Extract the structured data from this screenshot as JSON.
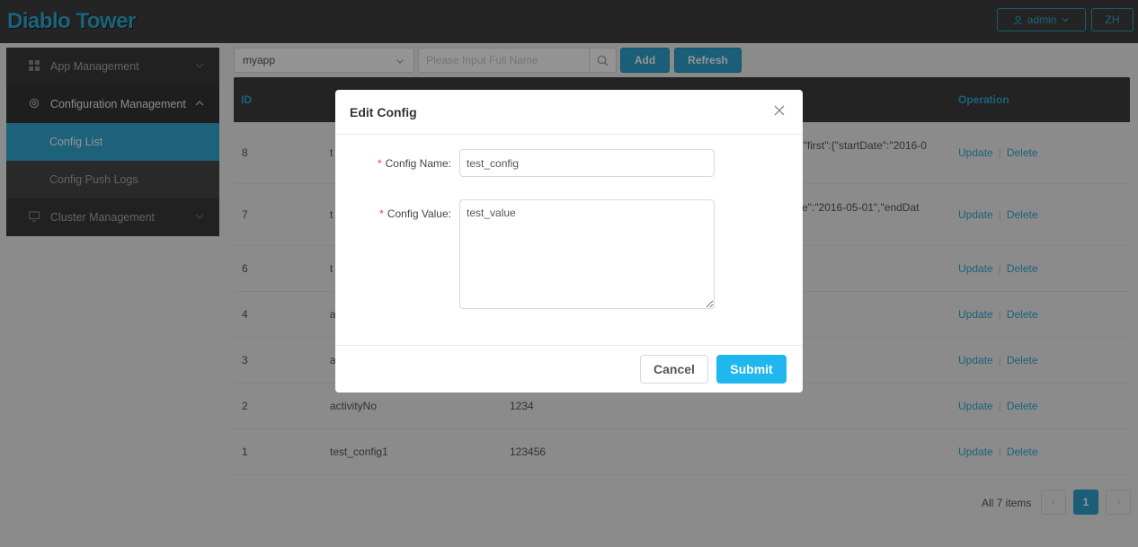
{
  "header": {
    "brand": "Diablo Tower",
    "user_label": "admin",
    "lang_label": "ZH"
  },
  "sidebar": {
    "items": [
      {
        "label": "App Management",
        "icon": "grid-icon",
        "expanded": false
      },
      {
        "label": "Configuration Management",
        "icon": "gear-icon",
        "expanded": true
      },
      {
        "label": "Config List",
        "active": true
      },
      {
        "label": "Config Push Logs"
      },
      {
        "label": "Cluster Management",
        "icon": "monitor-icon",
        "expanded": false
      }
    ]
  },
  "toolbar": {
    "app_value": "myapp",
    "search_placeholder": "Please Input Full Name",
    "add_label": "Add",
    "refresh_label": "Refresh"
  },
  "table": {
    "columns": {
      "id": "ID",
      "operation": "Operation"
    },
    "rows": [
      {
        "id": "8",
        "name": "t",
        "value": "\"},\"first\":{\"startDate\":\"2016-0",
        "update": "Update",
        "delete": "Delete"
      },
      {
        "id": "7",
        "name": "t",
        "value": "ate\":\"2016-05-01\",\"endDat",
        "update": "Update",
        "delete": "Delete"
      },
      {
        "id": "6",
        "name": "t",
        "value": "",
        "update": "Update",
        "delete": "Delete"
      },
      {
        "id": "4",
        "name": "a",
        "value": "",
        "update": "Update",
        "delete": "Delete"
      },
      {
        "id": "3",
        "name": "a",
        "value": "",
        "update": "Update",
        "delete": "Delete"
      },
      {
        "id": "2",
        "name": "activityNo",
        "value": "1234",
        "update": "Update",
        "delete": "Delete"
      },
      {
        "id": "1",
        "name": "test_config1",
        "value": "123456",
        "update": "Update",
        "delete": "Delete"
      }
    ]
  },
  "pagination": {
    "total": "All 7 items",
    "current": "1"
  },
  "modal": {
    "title": "Edit Config",
    "name_label": "Config Name",
    "name_value": "test_config",
    "value_label": "Config Value",
    "value_value": "test_value",
    "cancel_label": "Cancel",
    "submit_label": "Submit"
  },
  "colors": {
    "accent": "#2ea3cf",
    "header_bg": "#3f3f3f",
    "sidebar_bg": "#3a3a3a",
    "submit": "#1fb7ee",
    "required": "#f04134"
  }
}
